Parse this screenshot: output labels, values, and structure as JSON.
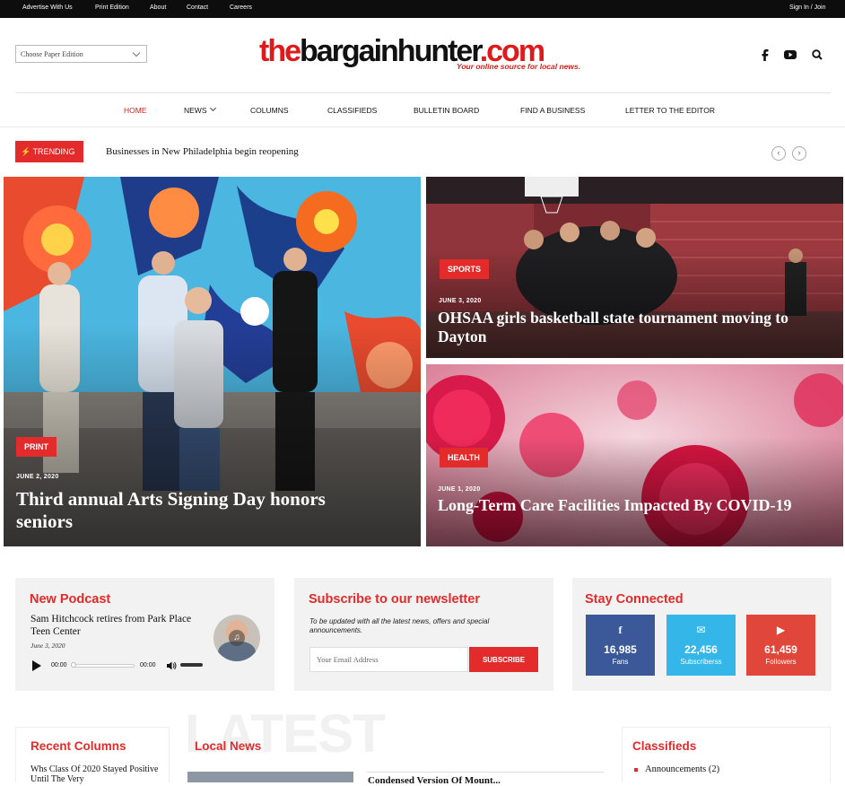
{
  "topbar": {
    "links": [
      "Advertise With Us",
      "Print Edition",
      "About",
      "Contact",
      "Careers"
    ],
    "signin": "Sign In / Join"
  },
  "header": {
    "paper_select": "Choose Paper Edition",
    "logo_part1": "the",
    "logo_part2": "bargainhunter",
    "logo_part3": ".com",
    "tagline": "Your online source for local news."
  },
  "nav": {
    "items": [
      "HOME",
      "NEWS",
      "COLUMNS",
      "CLASSIFIEDS",
      "BULLETIN BOARD",
      "FIND A BUSINESS",
      "LETTER TO THE EDITOR"
    ]
  },
  "trending": {
    "label": "TRENDING",
    "headline": "Businesses in New Philadelphia begin reopening"
  },
  "featured": [
    {
      "category": "PRINT",
      "date": "JUNE 2, 2020",
      "title": "Third annual Arts Signing Day honors seniors"
    },
    {
      "category": "SPORTS",
      "date": "JUNE 3, 2020",
      "title": "OHSAA girls basketball state tournament moving to Dayton"
    },
    {
      "category": "HEALTH",
      "date": "JUNE 1, 2020",
      "title": "Long-Term Care Facilities Impacted By COVID-19"
    }
  ],
  "podcast": {
    "title": "New Podcast",
    "episode": "Sam Hitchcock retires from Park Place Teen Center",
    "date": "June 3, 2020",
    "time_current": "00:00",
    "time_total": "00:00"
  },
  "newsletter": {
    "title": "Subscribe to our newsletter",
    "description": "To be updated with all the latest news, offers and special announcements.",
    "placeholder": "Your Email Address",
    "button": "SUBSCRIBE"
  },
  "stay_connected": {
    "title": "Stay Connected",
    "items": [
      {
        "count": "16,985",
        "label": "Fans",
        "icon": "facebook-icon",
        "color": "#3b5998"
      },
      {
        "count": "22,456",
        "label": "Subscriberss",
        "icon": "mail-icon",
        "color": "#34b6e8"
      },
      {
        "count": "61,459",
        "label": "Followers",
        "icon": "youtube-icon",
        "color": "#e0463a"
      }
    ]
  },
  "bottom": {
    "recent_columns": "Recent Columns",
    "recent_column_item": "Whs Class Of 2020 Stayed Positive Until The Very",
    "local_news": "Local News",
    "latest_watermark": "LATEST",
    "local_news_item": "Condensed Version Of Mount...",
    "classifieds": "Classifieds",
    "classifieds_item": "Announcements",
    "classifieds_count": "(2)"
  },
  "colors": {
    "accent": "#e32b2b",
    "topbar": "#0d0d0d"
  }
}
